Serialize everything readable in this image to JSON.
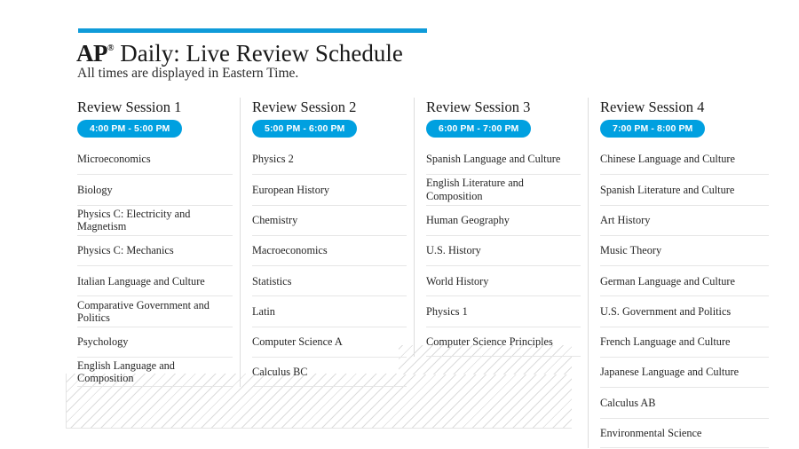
{
  "header": {
    "title_ap": "AP",
    "title_reg": "®",
    "title_rest": " Daily: Live Review Schedule",
    "subtitle": "All times are displayed in Eastern Time.",
    "accent_color": "#0F9BD9",
    "badge_color": "#00A0E0"
  },
  "columns": [
    {
      "heading": "Review Session 1",
      "time": "4:00 PM - 5:00 PM",
      "courses": [
        "Microeconomics",
        "Biology",
        "Physics C: Electricity and Magnetism",
        "Physics C: Mechanics",
        "Italian Language and Culture",
        "Comparative Government and Politics",
        "Psychology",
        "English Language and Composition"
      ]
    },
    {
      "heading": "Review Session 2",
      "time": "5:00 PM - 6:00 PM",
      "courses": [
        "Physics 2",
        "European History",
        "Chemistry",
        "Macroeconomics",
        "Statistics",
        "Latin",
        "Computer Science A",
        "Calculus BC"
      ]
    },
    {
      "heading": "Review Session 3",
      "time": "6:00 PM - 7:00 PM",
      "courses": [
        "Spanish Language and Culture",
        "English Literature and Composition",
        "Human Geography",
        "U.S. History",
        "World History",
        "Physics 1",
        "Computer Science Principles"
      ]
    },
    {
      "heading": "Review Session 4",
      "time": "7:00 PM - 8:00 PM",
      "courses": [
        "Chinese Language and Culture",
        "Spanish Literature and Culture",
        "Art History",
        "Music Theory",
        "German Language and Culture",
        "U.S. Government and Politics",
        "French Language and Culture",
        "Japanese Language and Culture",
        "Calculus AB",
        "Environmental Science"
      ]
    }
  ]
}
